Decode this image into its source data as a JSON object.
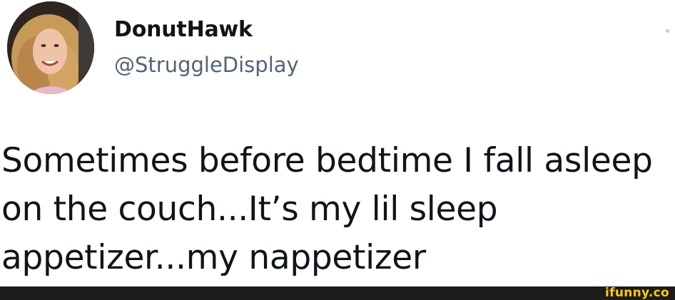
{
  "tweet": {
    "author": {
      "display_name": "DonutHawk",
      "handle": "@StruggleDisplay"
    },
    "text_lines": [
      "Sometimes before bedtime I fall asleep",
      "on the couch...It’s my lil sleep",
      "appetizer...my nappetizer"
    ]
  },
  "watermark": {
    "text": "ifunny.co"
  },
  "colors": {
    "text": "#0f1419",
    "handle": "#536471",
    "footer": "#1c1c1c",
    "watermark": "#ffcc00"
  }
}
